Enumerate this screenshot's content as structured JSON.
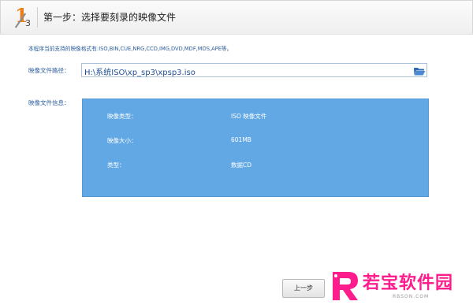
{
  "header": {
    "step_number": "1",
    "step_total": "3",
    "title": "第一步：选择要刻录的映像文件"
  },
  "formats_note": "本程序当前支持的映像格式有:ISO,BIN,CUE,NRG,CCD,IMG,DVD,MDF,MDS,APE等。",
  "path": {
    "label": "映像文件路径：",
    "value": "H:\\系统ISO\\xp_sp3\\xpsp3.iso",
    "browse_icon": "folder-open-icon"
  },
  "info": {
    "label": "映像文件信息：",
    "rows": [
      {
        "key": "映像类型：",
        "value": "ISO 映像文件"
      },
      {
        "key": "映像大小：",
        "value": "601MB"
      },
      {
        "key": "类型：",
        "value": "数据CD"
      }
    ]
  },
  "buttons": {
    "prev": "上一步"
  },
  "watermark": {
    "text": "若宝软件园",
    "url": "RBSON.COM"
  },
  "colors": {
    "accent": "#e87f1b",
    "label_blue": "#2d5fa0",
    "info_bg": "#62a8e5",
    "watermark_pink": "#ff1d8e"
  }
}
